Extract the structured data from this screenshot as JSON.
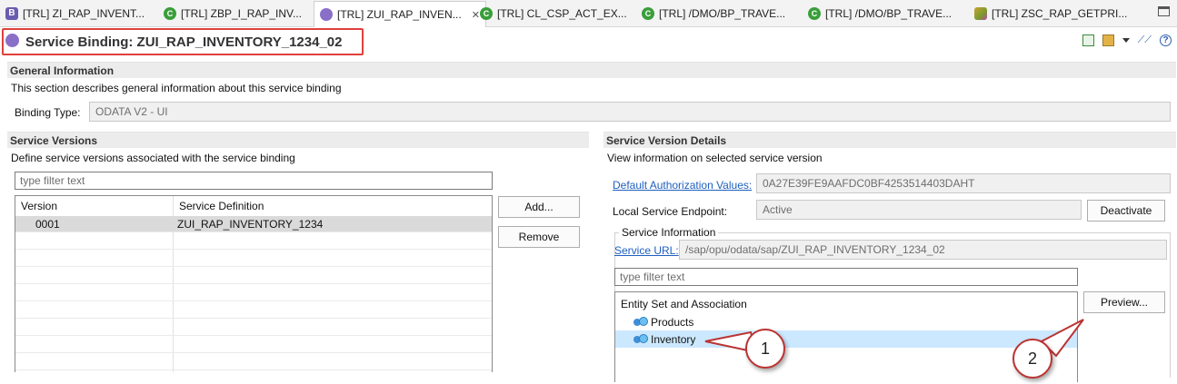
{
  "tabs": [
    {
      "label": "[TRL] ZI_RAP_INVENT...",
      "icon": "behavior-icon",
      "active": false
    },
    {
      "label": "[TRL] ZBP_I_RAP_INV...",
      "icon": "class-icon",
      "active": false
    },
    {
      "label": "[TRL] ZUI_RAP_INVEN...",
      "icon": "service-binding-icon",
      "active": true
    },
    {
      "label": "[TRL] CL_CSP_ACT_EX...",
      "icon": "class-icon",
      "active": false
    },
    {
      "label": "[TRL] /DMO/BP_TRAVE...",
      "icon": "class-icon",
      "active": false
    },
    {
      "label": "[TRL] /DMO/BP_TRAVE...",
      "icon": "class-icon",
      "active": false
    },
    {
      "label": "[TRL] ZSC_RAP_GETPRI...",
      "icon": "program-icon",
      "active": false
    }
  ],
  "editor": {
    "title": "Service Binding: ZUI_RAP_INVENTORY_1234_02",
    "help_glyph": "?"
  },
  "general": {
    "header": "General Information",
    "description": "This section describes general information about this service binding",
    "binding_type_label": "Binding Type:",
    "binding_type_value": "ODATA V2 - UI"
  },
  "versions": {
    "header": "Service Versions",
    "description": "Define service versions associated with the service binding",
    "filter_placeholder": "type filter text",
    "columns": [
      "Version",
      "Service Definition"
    ],
    "rows": [
      {
        "version": "0001",
        "definition": "ZUI_RAP_INVENTORY_1234"
      }
    ],
    "add_label": "Add...",
    "remove_label": "Remove"
  },
  "details": {
    "header": "Service Version Details",
    "description": "View information on selected service version",
    "auth_label": "Default Authorization Values:",
    "auth_value": "0A27E39FE9AAFDC0BF4253514403DAHT",
    "endpoint_label": "Local Service Endpoint:",
    "endpoint_value": "Active",
    "deactivate_label": "Deactivate",
    "service_info_title": "Service Information",
    "service_url_label": "Service URL:",
    "service_url_value": "/sap/opu/odata/sap/ZUI_RAP_INVENTORY_1234_02",
    "filter_placeholder": "type filter text",
    "entity_header": "Entity Set and Association",
    "entities": [
      "Products",
      "Inventory"
    ],
    "preview_label": "Preview..."
  },
  "callouts": [
    "1",
    "2"
  ],
  "colors": {
    "highlight_border": "#e0403c",
    "link": "#1f5fbf",
    "selection": "#cce8ff"
  }
}
